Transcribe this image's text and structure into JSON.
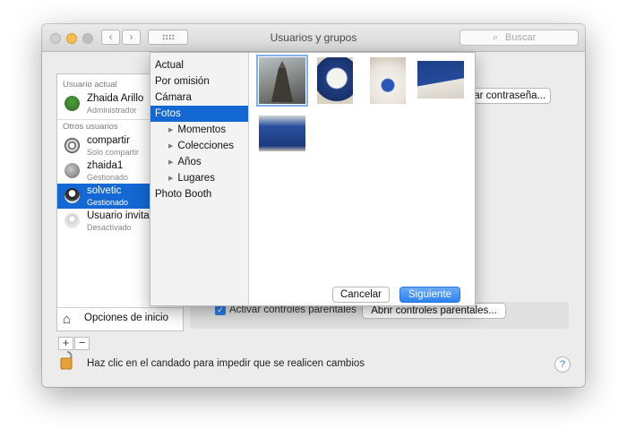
{
  "window": {
    "title": "Usuarios y grupos",
    "search_placeholder": "Buscar"
  },
  "sidebar": {
    "current_user_header": "Usuario actual",
    "other_users_header": "Otros usuarios",
    "users": [
      {
        "name": "Zhaida Arillo",
        "role": "Administrador"
      },
      {
        "name": "compartir",
        "role": "Solo compartir"
      },
      {
        "name": "zhaida1",
        "role": "Gestionado"
      },
      {
        "name": "solvetic",
        "role": "Gestionado"
      },
      {
        "name": "Usuario invitado",
        "role": "Desactivado"
      }
    ],
    "options_label": "Opciones de inicio",
    "add_label": "+",
    "remove_label": "−"
  },
  "panel": {
    "change_password_button": "Cambiar contraseña...",
    "parental_checkbox_label": "Activar controles parentales",
    "parental_button": "Abrir controles parentales..."
  },
  "lock_text": "Haz clic en el candado para impedir que se realicen cambios",
  "help_label": "?",
  "dialog": {
    "sources": [
      {
        "label": "Actual",
        "sub": false
      },
      {
        "label": "Por omisión",
        "sub": false
      },
      {
        "label": "Cámara",
        "sub": false
      },
      {
        "label": "Fotos",
        "sub": false,
        "selected": true
      },
      {
        "label": "Momentos",
        "sub": true
      },
      {
        "label": "Colecciones",
        "sub": true
      },
      {
        "label": "Años",
        "sub": true
      },
      {
        "label": "Lugares",
        "sub": true
      },
      {
        "label": "Photo Booth",
        "sub": false
      }
    ],
    "cancel_button": "Cancelar",
    "next_button": "Siguiente"
  },
  "colors": {
    "selection_blue": "#1468d4",
    "primary_button": "#3b8ff5"
  }
}
